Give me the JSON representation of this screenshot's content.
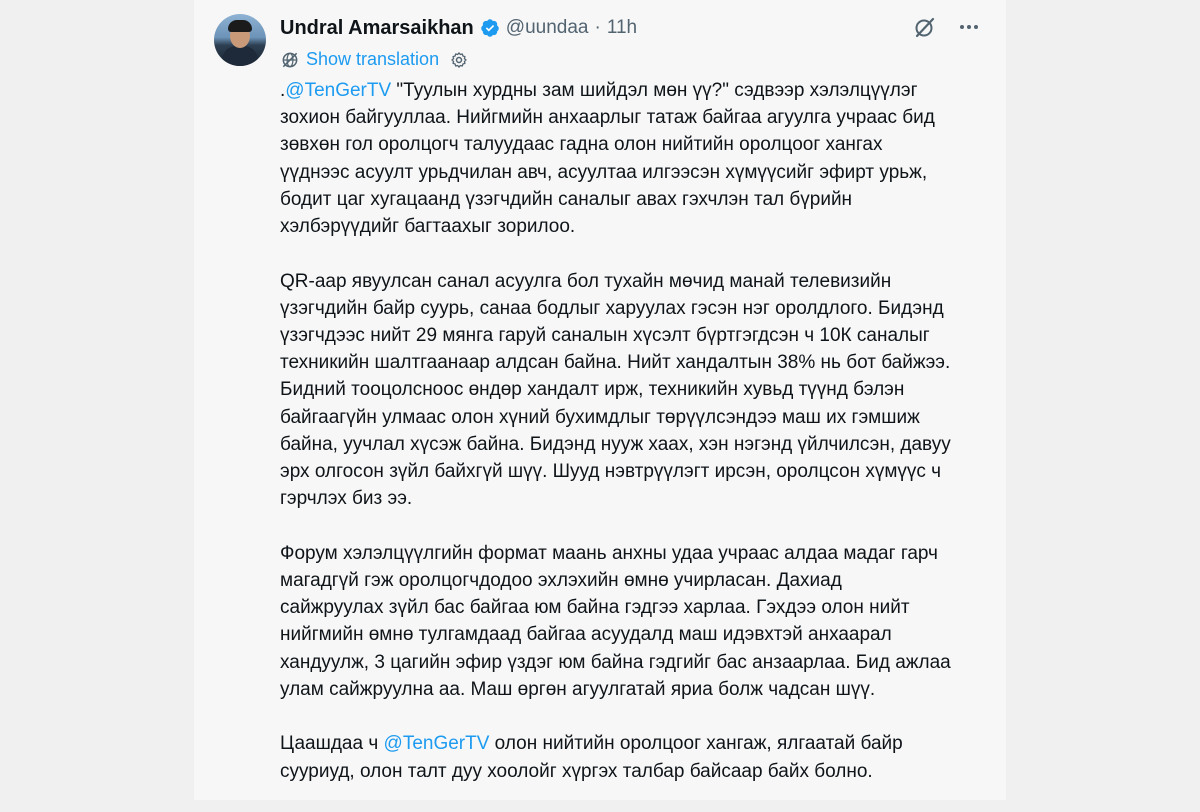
{
  "user": {
    "name": "Undral Amarsaikhan",
    "handle": "@uundaa",
    "separator": "·",
    "time": "11h"
  },
  "translate_label": "Show translation",
  "paragraphs": [
    [
      [
        ".",
        {
          "mention": "@TenGerTV"
        },
        " \"Туулын хурдны зам шийдэл мөн үү?\" сэдвээр хэлэлцүүлэг"
      ],
      [
        "зохион байгууллаа. Нийгмийн анхаарлыг татаж байгаа агуулга учраас бид"
      ],
      [
        "зөвхөн гол оролцогч талуудаас гадна олон нийтийн оролцоог хангах"
      ],
      [
        "үүднээс асуулт урьдчилан авч, асуултаа илгээсэн хүмүүсийг эфирт урьж,"
      ],
      [
        "бодит цаг хугацаанд үзэгчдийн саналыг авах гэхчлэн тал бүрийн"
      ],
      [
        "хэлбэрүүдийг багтаахыг зорилоо."
      ]
    ],
    [
      [
        "QR-аар явуулсан санал асуулга бол тухайн мөчид манай телевизийн"
      ],
      [
        "үзэгчдийн байр суурь, санаа бодлыг харуулах гэсэн нэг оролдлого. Бидэнд"
      ],
      [
        "үзэгчдээс нийт 29 мянга гаруй саналын хүсэлт бүртгэгдсэн ч 10К саналыг"
      ],
      [
        "техникийн шалтгаанаар алдсан байна. Нийт хандалтын 38% нь бот байжээ."
      ],
      [
        "Бидний тооцолсноос өндөр хандалт ирж, техникийн хувьд түүнд бэлэн"
      ],
      [
        "байгаагүйн улмаас олон хүний бухимдлыг төрүүлсэндээ маш их гэмшиж"
      ],
      [
        "байна, уучлал хүсэж байна. Бидэнд нууж хаах, хэн нэгэнд үйлчилсэн, давуу"
      ],
      [
        "эрх олгосон зүйл байхгүй шүү. Шууд нэвтрүүлэгт ирсэн, оролцсон хүмүүс ч"
      ],
      [
        "гэрчлэх биз ээ."
      ]
    ],
    [
      [
        "Форум хэлэлцүүлгийн формат маань анхны удаа учраас алдаа мадаг гарч"
      ],
      [
        "магадгүй гэж оролцогчдодоо эхлэхийн өмнө учирласан. Дахиад"
      ],
      [
        "сайжруулах зүйл бас байгаа юм байна гэдгээ харлаа. Гэхдээ олон нийт"
      ],
      [
        "нийгмийн өмнө тулгамдаад байгаа асуудалд маш идэвхтэй анхаарал"
      ],
      [
        "хандуулж, 3 цагийн эфир үздэг юм байна гэдгийг бас анзаарлаа. Бид ажлаа"
      ],
      [
        "улам сайжруулна аа. Маш өргөн агуулгатай яриа болж чадсан шүү."
      ]
    ],
    [
      [
        "Цаашдаа ч ",
        {
          "mention": "@TenGerTV"
        },
        " олон нийтийн оролцоог хангаж, ялгаатай байр"
      ],
      [
        "сууриуд, олон талт дуу хоолойг хүргэх талбар байсаар байх болно."
      ]
    ]
  ],
  "icons": {
    "verified": "verified-badge-icon",
    "grok": "grok-icon",
    "more": "more-options-icon",
    "translate": "translate-globe-icon",
    "settings": "settings-gear-icon"
  },
  "colors": {
    "accent": "#1d9bf0",
    "text": "#0f1419",
    "secondary": "#536471"
  }
}
